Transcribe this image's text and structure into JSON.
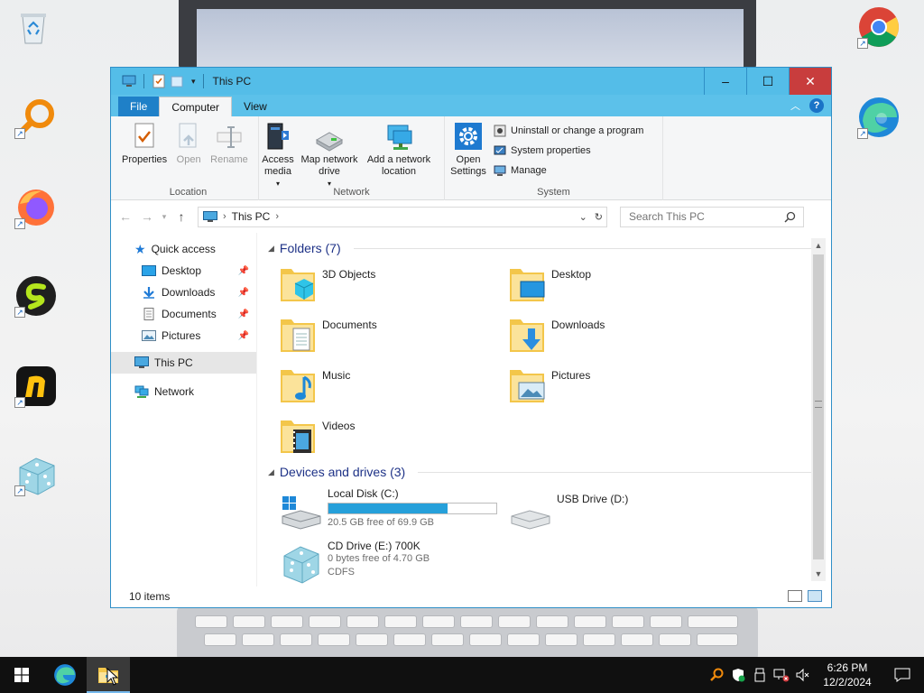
{
  "window": {
    "title": "This PC",
    "tabs": {
      "file": "File",
      "computer": "Computer",
      "view": "View"
    },
    "controls": {
      "minimize": "–",
      "maximize": "☐",
      "close": "✕"
    }
  },
  "ribbon": {
    "location": {
      "label": "Location",
      "properties": "Properties",
      "open": "Open",
      "rename": "Rename"
    },
    "network": {
      "label": "Network",
      "access_media": "Access media",
      "map_drive": "Map network drive",
      "add_location": "Add a network location"
    },
    "system": {
      "label": "System",
      "open_settings": "Open Settings",
      "uninstall": "Uninstall or change a program",
      "system_properties": "System properties",
      "manage": "Manage"
    }
  },
  "address": {
    "path": "This PC",
    "search_placeholder": "Search This PC"
  },
  "navpane": {
    "quick_access": "Quick access",
    "desktop": "Desktop",
    "downloads": "Downloads",
    "documents": "Documents",
    "pictures": "Pictures",
    "this_pc": "This PC",
    "network": "Network"
  },
  "folders": {
    "header": "Folders (7)",
    "items": [
      "3D Objects",
      "Desktop",
      "Documents",
      "Downloads",
      "Music",
      "Pictures",
      "Videos"
    ]
  },
  "drives": {
    "header": "Devices and drives (3)",
    "local": {
      "name": "Local Disk (C:)",
      "free": "20.5 GB free of 69.9 GB",
      "used_fraction": 0.707
    },
    "usb": {
      "name": "USB Drive (D:)"
    },
    "cd": {
      "name": "CD Drive (E:) 700K",
      "free": "0 bytes free of 4.70 GB",
      "fs": "CDFS"
    }
  },
  "status": {
    "items": "10 items"
  },
  "taskbar": {
    "time": "6:26 PM",
    "date": "12/2/2024"
  },
  "colors": {
    "titlebar": "#54bde8",
    "close": "#c83d3d",
    "drive_fill": "#26a0da",
    "section_header": "#1e3287"
  }
}
